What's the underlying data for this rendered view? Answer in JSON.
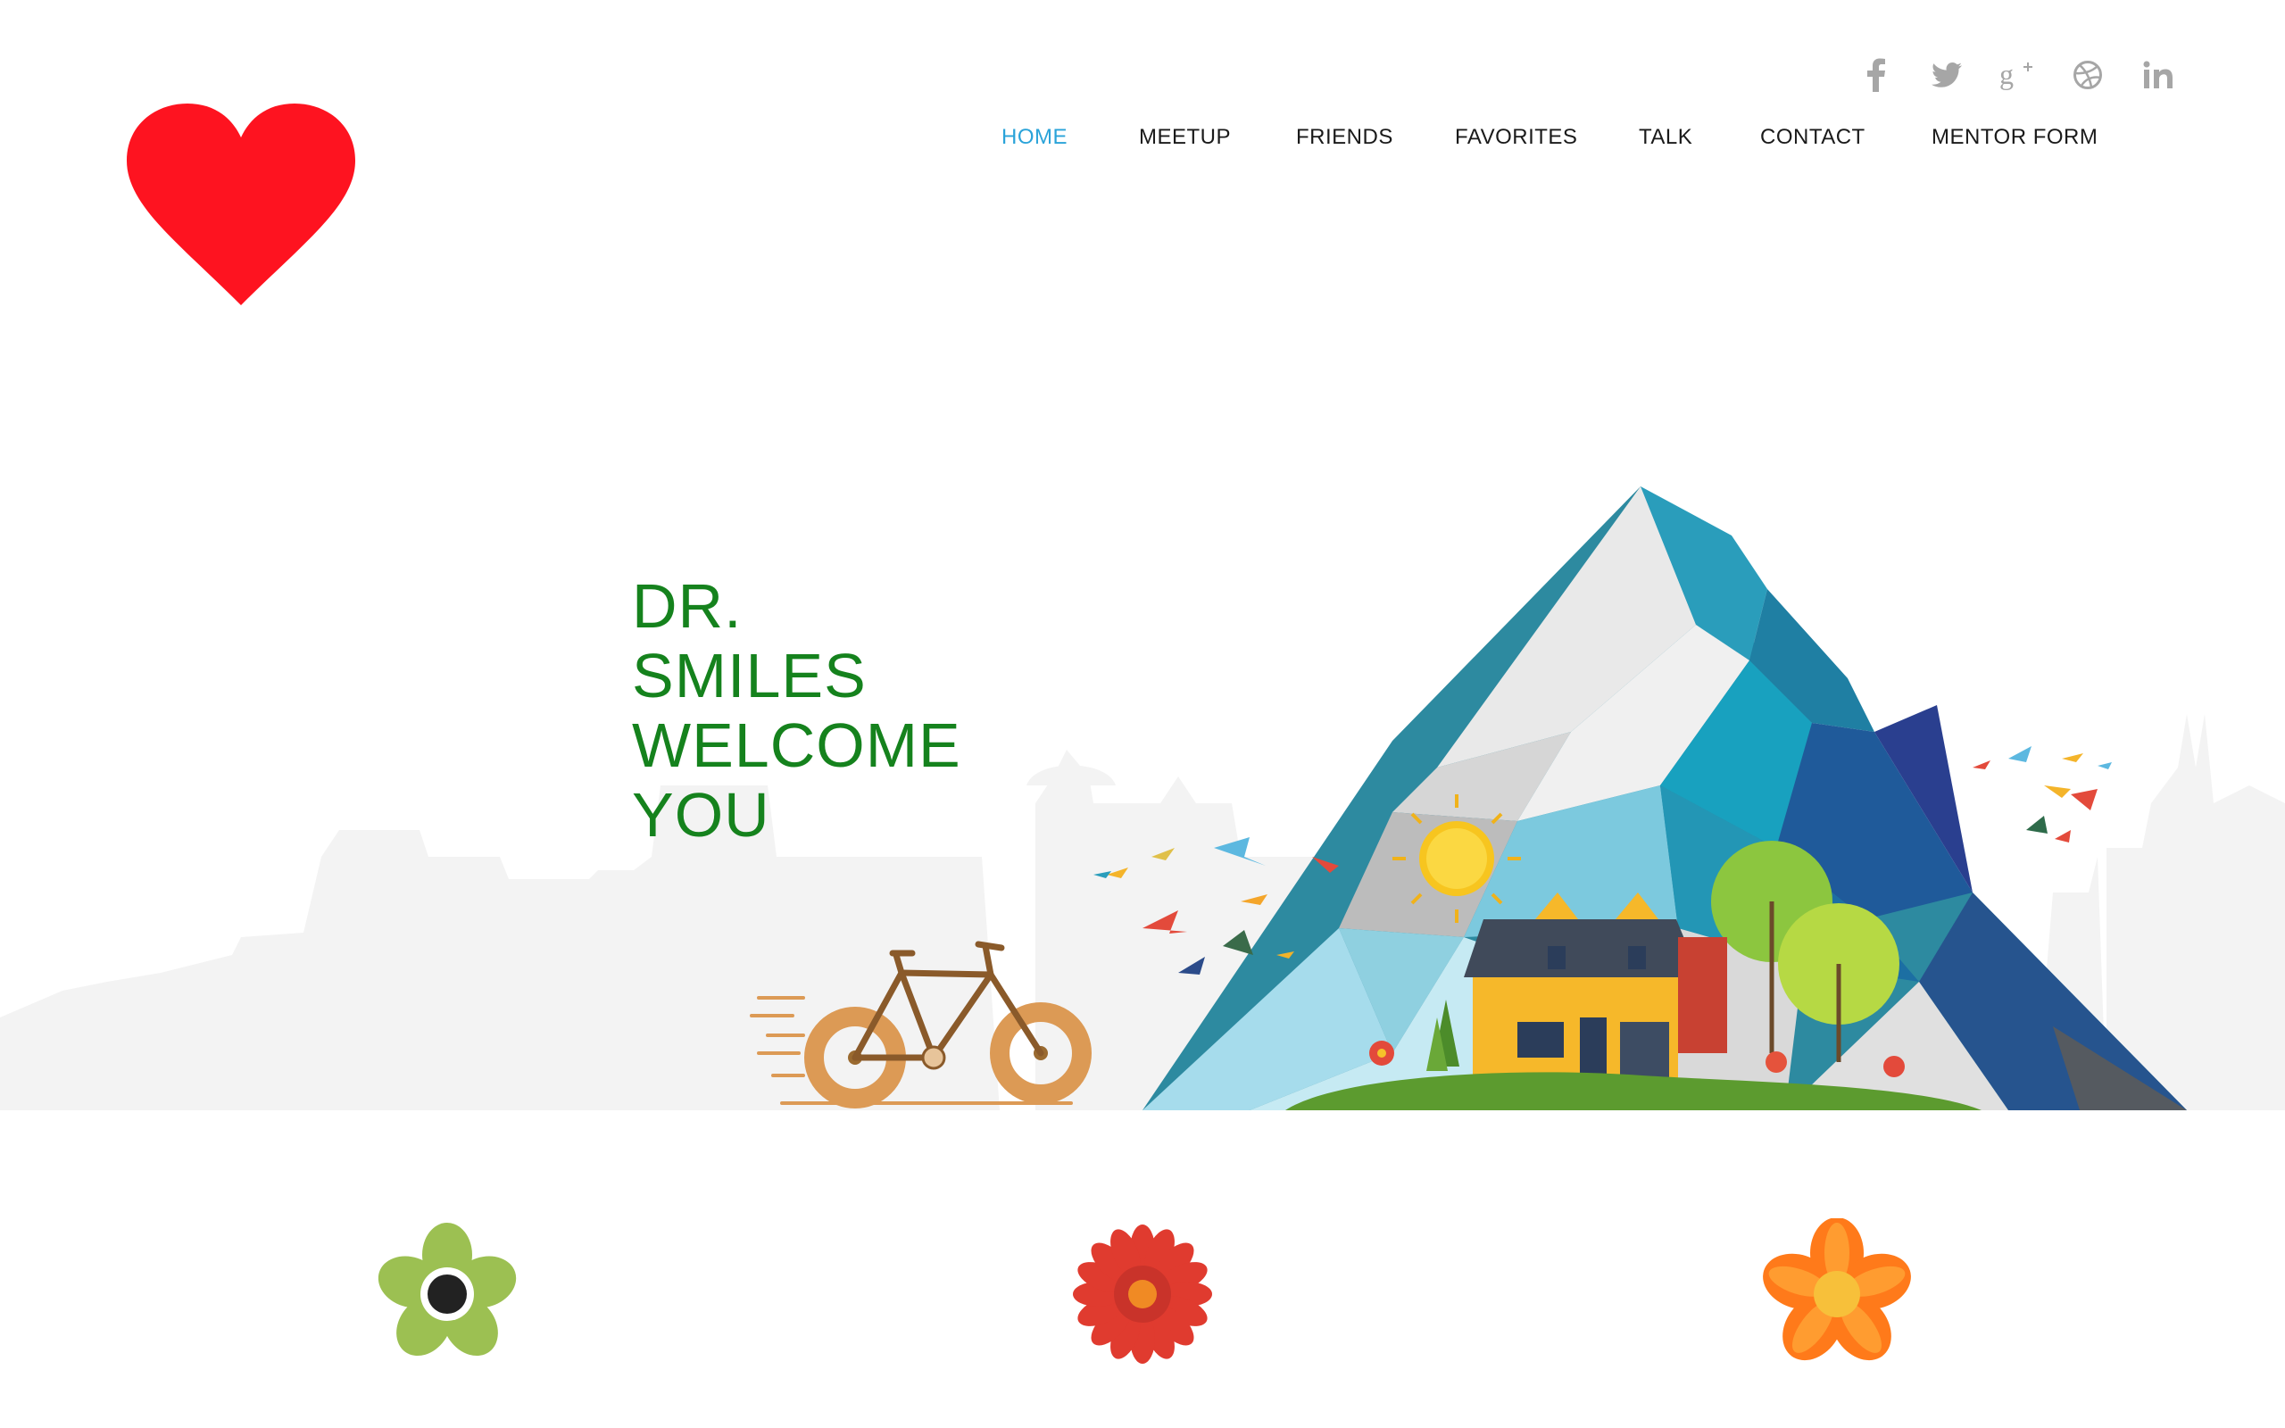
{
  "logo": {
    "icon": "heart-icon",
    "color": "#fe1320"
  },
  "social": [
    {
      "icon": "facebook-icon",
      "glyph": "f"
    },
    {
      "icon": "twitter-icon",
      "glyph": ""
    },
    {
      "icon": "google-plus-icon",
      "glyph": "g+"
    },
    {
      "icon": "dribbble-icon",
      "glyph": ""
    },
    {
      "icon": "linkedin-icon",
      "glyph": "in"
    }
  ],
  "nav": {
    "items": [
      "HOME",
      "MEETUP",
      "FRIENDS",
      "FAVORITES",
      "TALK",
      "CONTACT",
      "MENTOR FORM"
    ],
    "active": "HOME"
  },
  "hero": {
    "headline_lines": [
      "DR.",
      "SMILES",
      "WELCOME",
      "YOU"
    ],
    "headline_color": "#15821d"
  },
  "features": [
    {
      "icon": "green-flower-icon",
      "color": "#9cc052"
    },
    {
      "icon": "red-flower-icon",
      "color": "#e03b2f"
    },
    {
      "icon": "orange-flower-icon",
      "color": "#ff7a1a"
    }
  ],
  "colors": {
    "accent": "#2aa3d9",
    "nav_text": "#1a1a1a",
    "social_icon": "#a6a6a6",
    "skyline": "#f3f3f3"
  }
}
